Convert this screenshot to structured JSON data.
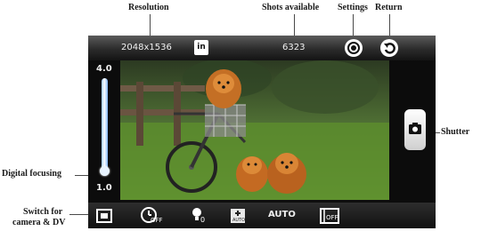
{
  "callouts": {
    "resolution": "Resolution",
    "shots_available": "Shots available",
    "settings": "Settings",
    "return": "Return",
    "shutter": "Shutter",
    "digital_focusing": "Digital focusing",
    "switch_line1": "Switch for",
    "switch_line2": "camera & DV"
  },
  "top_bar": {
    "resolution_value": "2048x1536",
    "in_badge": "in",
    "shots_value": "6323",
    "settings_icon": "settings-icon",
    "return_icon": "return-icon"
  },
  "zoom": {
    "max_label": "4.0",
    "min_label": "1.0",
    "level": 0.0
  },
  "shutter": {
    "icon": "camera-icon"
  },
  "bottom_bar": {
    "timer_icon": "self-timer-off-icon",
    "timer_text": "OFF",
    "flash_icon": "flash-off-icon",
    "flash_text": "0",
    "white_balance_icon": "white-balance-auto-icon",
    "wb_text": "AUTO",
    "auto_label": "AUTO",
    "film_icon": "burst-off-icon",
    "film_text": "OFF",
    "switch_icon": "camera-dv-switch-icon"
  },
  "colors": {
    "bar_dark": "#141414",
    "accent_blue": "#7eb5ff",
    "grass": "#5c8f2d"
  }
}
